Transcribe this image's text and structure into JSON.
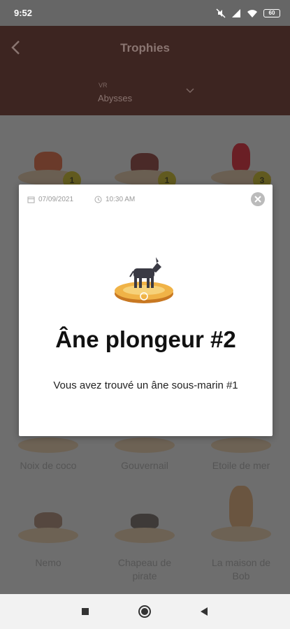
{
  "status": {
    "time": "9:52",
    "battery": "60"
  },
  "appbar": {
    "title": "Trophies",
    "dropdown_label": "VR",
    "dropdown_value": "Abysses"
  },
  "trophies": [
    {
      "name": "",
      "count": "1"
    },
    {
      "name": "",
      "count": "1"
    },
    {
      "name": "",
      "count": "3"
    },
    {
      "name": "Noix de coco"
    },
    {
      "name": "Gouvernail"
    },
    {
      "name": "Etoile de mer"
    },
    {
      "name": "Nemo"
    },
    {
      "name": "Chapeau de pirate"
    },
    {
      "name": "La maison de Bob"
    }
  ],
  "dialog": {
    "date": "07/09/2021",
    "time": "10:30 AM",
    "title": "Âne plongeur #2",
    "description": "Vous avez trouvé un âne sous-marin #1"
  },
  "icons": {
    "back": "back-arrow-icon",
    "chevron": "chevron-down-icon",
    "calendar": "calendar-icon",
    "clock": "clock-icon",
    "close": "close-icon",
    "nav_recents": "square-icon",
    "nav_home": "circle-icon",
    "nav_back": "triangle-back-icon"
  },
  "colors": {
    "appbar": "#3d2521",
    "scrim_content": "#6e6e6e",
    "badge": "#615a1f",
    "pedestal_gold": "#e8a23a"
  }
}
